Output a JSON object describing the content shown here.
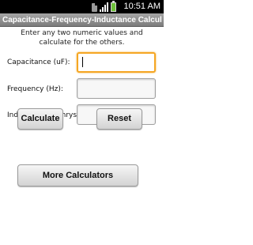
{
  "status_bar": {
    "time": "10:51 AM",
    "icons": [
      "sim-card-icon",
      "signal-strength-icon",
      "battery-icon"
    ],
    "battery_color": "#6ec23a"
  },
  "app": {
    "title": "Capacitance-Frequency-Inductance Calcula..."
  },
  "instructions": {
    "line1": "Enter any two numeric values and",
    "line2": "calculate for the others."
  },
  "fields": {
    "capacitance": {
      "label": "Capacitance (uF):",
      "value": ""
    },
    "frequency": {
      "label": "Frequency (Hz):",
      "value": ""
    },
    "inductance": {
      "label": "Inductance (Henrys):",
      "value": ""
    }
  },
  "buttons": {
    "calculate": "Calculate",
    "reset": "Reset",
    "more": "More Calculators"
  },
  "colors": {
    "title_bar": "#8c8c8c",
    "focus_ring": "#f5a623"
  }
}
